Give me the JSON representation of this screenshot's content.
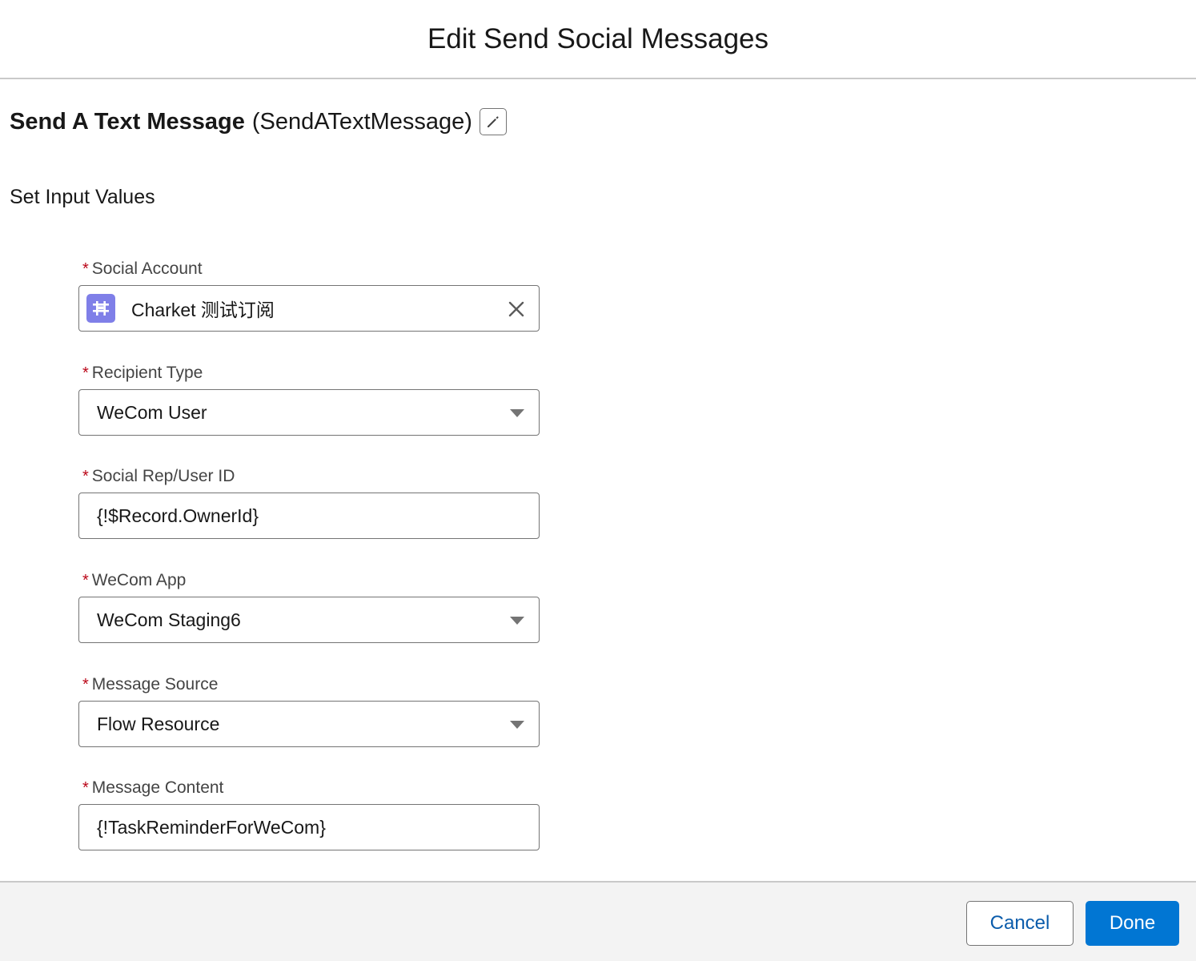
{
  "header": {
    "title": "Edit Send Social Messages"
  },
  "action": {
    "label": "Send A Text Message",
    "api_name": "(SendATextMessage)",
    "edit_icon": "pencil-icon"
  },
  "section": {
    "title": "Set Input Values"
  },
  "fields": {
    "social_account": {
      "label": "Social Account",
      "required_marker": "*",
      "value": "Charket 测试订阅",
      "icon": "wechat-account-icon",
      "clear_icon": "close-icon"
    },
    "recipient_type": {
      "label": "Recipient Type",
      "required_marker": "*",
      "value": "WeCom User",
      "icon": "chevron-down-icon"
    },
    "social_rep_user_id": {
      "label": "Social Rep/User ID",
      "required_marker": "*",
      "value": "{!$Record.OwnerId}"
    },
    "wecom_app": {
      "label": "WeCom App",
      "required_marker": "*",
      "value": "WeCom Staging6",
      "icon": "chevron-down-icon"
    },
    "message_source": {
      "label": "Message Source",
      "required_marker": "*",
      "value": "Flow Resource",
      "icon": "chevron-down-icon"
    },
    "message_content": {
      "label": "Message Content",
      "required_marker": "*",
      "value": "{!TaskReminderForWeCom}"
    }
  },
  "footer": {
    "cancel_label": "Cancel",
    "done_label": "Done"
  },
  "colors": {
    "brand_blue": "#0176d3",
    "link_blue": "#0b5cab",
    "required_red": "#ba0517",
    "account_icon_bg": "#7f7fe8",
    "border_gray": "#747474",
    "footer_bg": "#f3f3f3"
  }
}
